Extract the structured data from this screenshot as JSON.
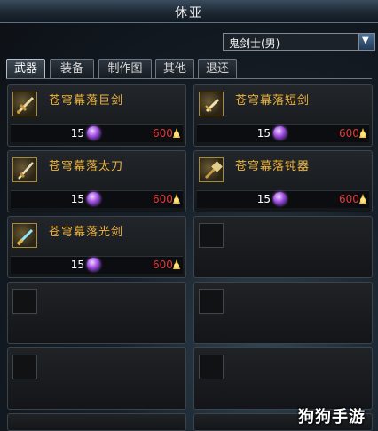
{
  "window": {
    "title": "休亚"
  },
  "class_select": {
    "value": "鬼剑士(男)",
    "arrow": "▼"
  },
  "tabs": [
    {
      "label": "武器",
      "active": true
    },
    {
      "label": "装备",
      "active": false
    },
    {
      "label": "制作图",
      "active": false
    },
    {
      "label": "其他",
      "active": false
    },
    {
      "label": "退还",
      "active": false
    }
  ],
  "items": [
    {
      "name": "苍穹幕落巨剑",
      "quantity": "15",
      "price": "600",
      "icon": "greatsword-icon"
    },
    {
      "name": "苍穹幕落短剑",
      "quantity": "15",
      "price": "600",
      "icon": "shortsword-icon"
    },
    {
      "name": "苍穹幕落太刀",
      "quantity": "15",
      "price": "600",
      "icon": "katana-icon"
    },
    {
      "name": "苍穹幕落钝器",
      "quantity": "15",
      "price": "600",
      "icon": "blunt-weapon-icon"
    },
    {
      "name": "苍穹幕落光剑",
      "quantity": "15",
      "price": "600",
      "icon": "lightsaber-icon"
    }
  ],
  "empty_slot_count": 5,
  "watermark": "狗狗手游",
  "colors": {
    "item_name": "#f0b43a",
    "price": "#e23a3a",
    "gem": "#a04fe0",
    "title_bar": "#1d2833"
  }
}
